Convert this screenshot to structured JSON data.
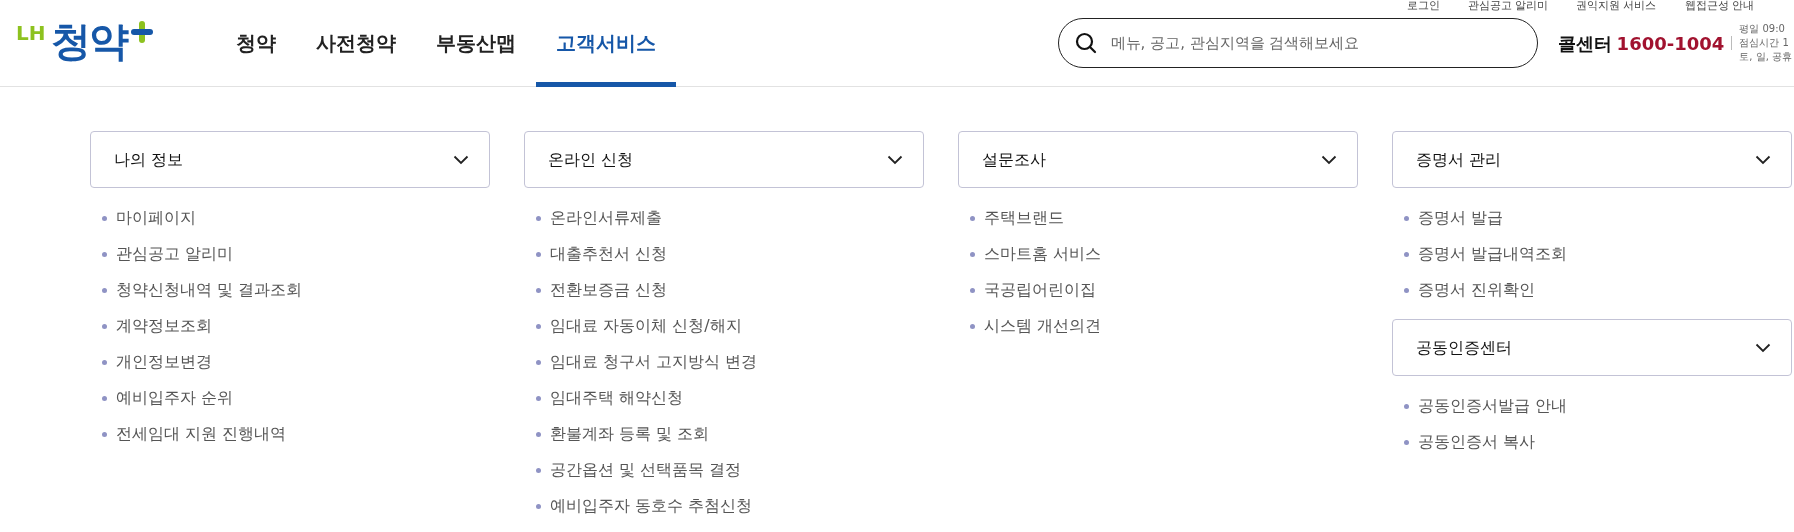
{
  "header": {
    "logo": {
      "prefix": "LH",
      "name": "청약"
    },
    "nav": [
      {
        "label": "청약",
        "selected": false
      },
      {
        "label": "사전청약",
        "selected": false
      },
      {
        "label": "부동산맵",
        "selected": false
      },
      {
        "label": "고객서비스",
        "selected": true
      }
    ],
    "utility_links": [
      "로그인",
      "관심공고 알리미",
      "권익지원 서비스",
      "웹접근성 안내"
    ],
    "search": {
      "placeholder": "메뉴, 공고, 관심지역을 검색해보세요"
    },
    "call_center": {
      "label": "콜센터",
      "number": "1600-1004"
    },
    "hours": [
      "평일 09:0",
      "점심시간 1",
      "토, 일, 공휴"
    ]
  },
  "menu_columns": [
    {
      "groups": [
        {
          "title": "나의 정보",
          "expanded": false,
          "items": [
            "마이페이지",
            "관심공고 알리미",
            "청약신청내역 및 결과조회",
            "계약정보조회",
            "개인정보변경",
            "예비입주자 순위",
            "전세임대 지원 진행내역"
          ]
        }
      ]
    },
    {
      "groups": [
        {
          "title": "온라인 신청",
          "expanded": false,
          "items": [
            "온라인서류제출",
            "대출추천서 신청",
            "전환보증금 신청",
            "임대료 자동이체 신청/해지",
            "임대료 청구서 고지방식 변경",
            "임대주택 해약신청",
            "환불계좌 등록 및 조회",
            "공간옵션 및 선택품목 결정",
            "예비입주자 동호수 추첨신청"
          ]
        }
      ]
    },
    {
      "groups": [
        {
          "title": "설문조사",
          "expanded": false,
          "items": [
            "주택브랜드",
            "스마트홈 서비스",
            "국공립어린이집",
            "시스템 개선의견"
          ]
        }
      ]
    },
    {
      "groups": [
        {
          "title": "증명서 관리",
          "expanded": false,
          "items": [
            "증명서 발급",
            "증명서 발급내역조회",
            "증명서 진위확인"
          ]
        },
        {
          "title": "공동인증센터",
          "expanded": false,
          "items": [
            "공동인증서발급 안내",
            "공동인증서 복사"
          ]
        }
      ]
    }
  ]
}
